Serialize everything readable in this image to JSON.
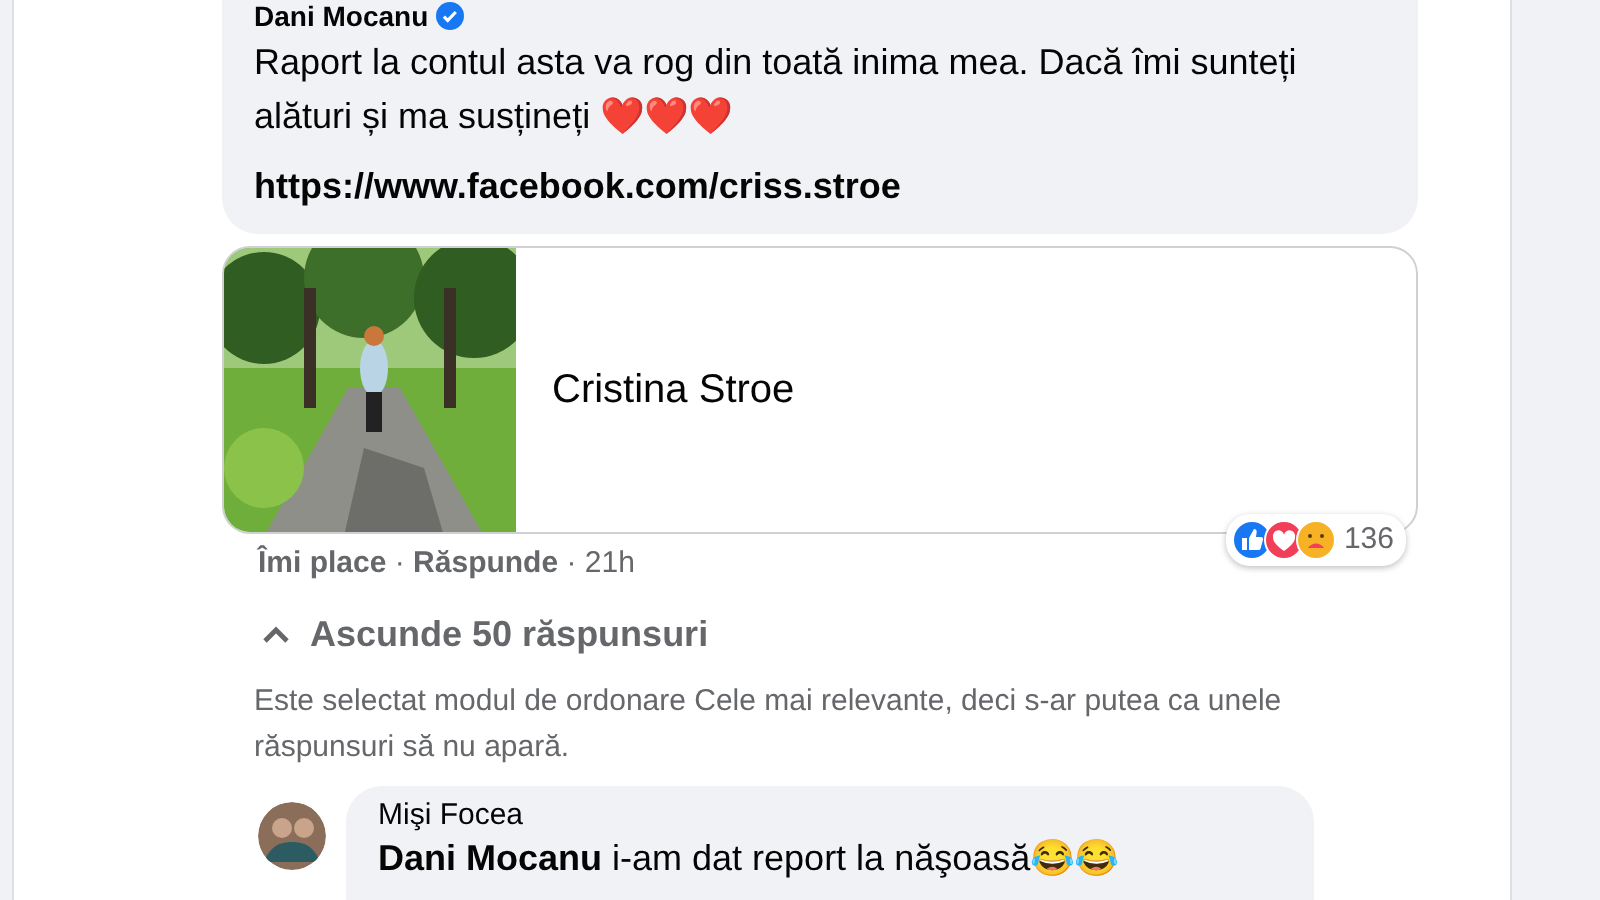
{
  "comment": {
    "author": "Dani Mocanu",
    "verified": true,
    "text": "Raport la contul asta va rog din toată inima mea. Dacă îmi sunteți alături și ma susțineți ❤️❤️❤️",
    "link": "https://www.facebook.com/criss.stroe"
  },
  "link_preview": {
    "title": "Cristina Stroe"
  },
  "reactions": {
    "count": "136"
  },
  "actions": [
    {
      "label": "Îmi place"
    },
    {
      "label": "Răspunde"
    }
  ],
  "separator": "·",
  "time": "21h",
  "replies_toggle": {
    "label": "Ascunde 50 răspunsuri",
    "expanded": true
  },
  "sort_notice": "Este selectat modul de ordonare Cele mai relevante, deci s-ar putea ca unele răspunsuri să nu apară.",
  "reply": {
    "author": "Mişi Focea",
    "text": "**Dani Mocanu** i-am dat report la năşoasă😂😂"
  }
}
